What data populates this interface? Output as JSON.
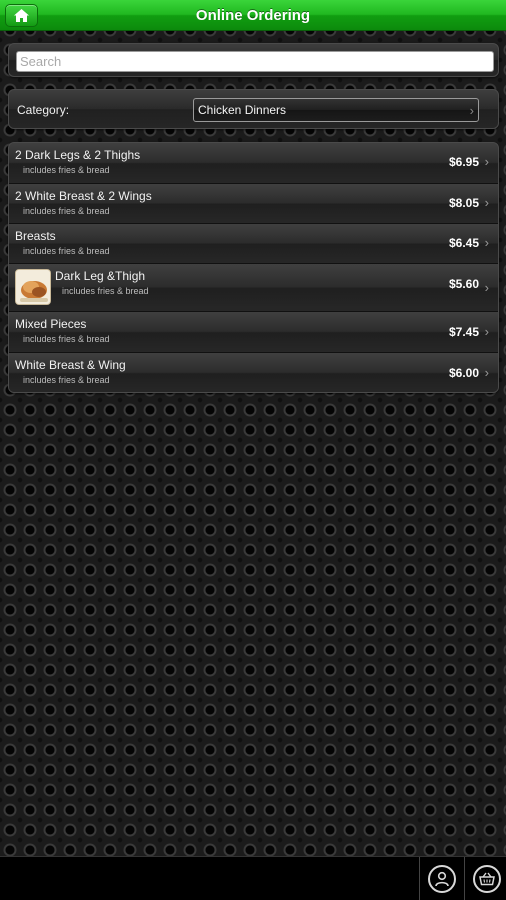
{
  "app": {
    "title": "Online Ordering"
  },
  "search": {
    "placeholder": "Search",
    "value": ""
  },
  "category": {
    "label": "Category:",
    "selected": "Chicken Dinners"
  },
  "items": [
    {
      "name": "2 Dark Legs & 2 Thighs",
      "desc": "includes fries & bread",
      "price": "$6.95",
      "has_image": false
    },
    {
      "name": "2 White Breast & 2 Wings",
      "desc": "includes fries & bread",
      "price": "$8.05",
      "has_image": false
    },
    {
      "name": "Breasts",
      "desc": "includes fries & bread",
      "price": "$6.45",
      "has_image": false
    },
    {
      "name": "Dark Leg &Thigh",
      "desc": "includes fries & bread",
      "price": "$5.60",
      "has_image": true
    },
    {
      "name": "Mixed Pieces",
      "desc": "includes fries & bread",
      "price": "$7.45",
      "has_image": false
    },
    {
      "name": "White Breast & Wing",
      "desc": "includes fries & bread",
      "price": "$6.00",
      "has_image": false
    }
  ],
  "icons": {
    "home": "home-icon",
    "chevron": "chevron-right-icon",
    "account": "user-icon",
    "cart": "basket-icon"
  },
  "colors": {
    "topbar_green": "#20b820",
    "background": "#1b1b1b"
  }
}
